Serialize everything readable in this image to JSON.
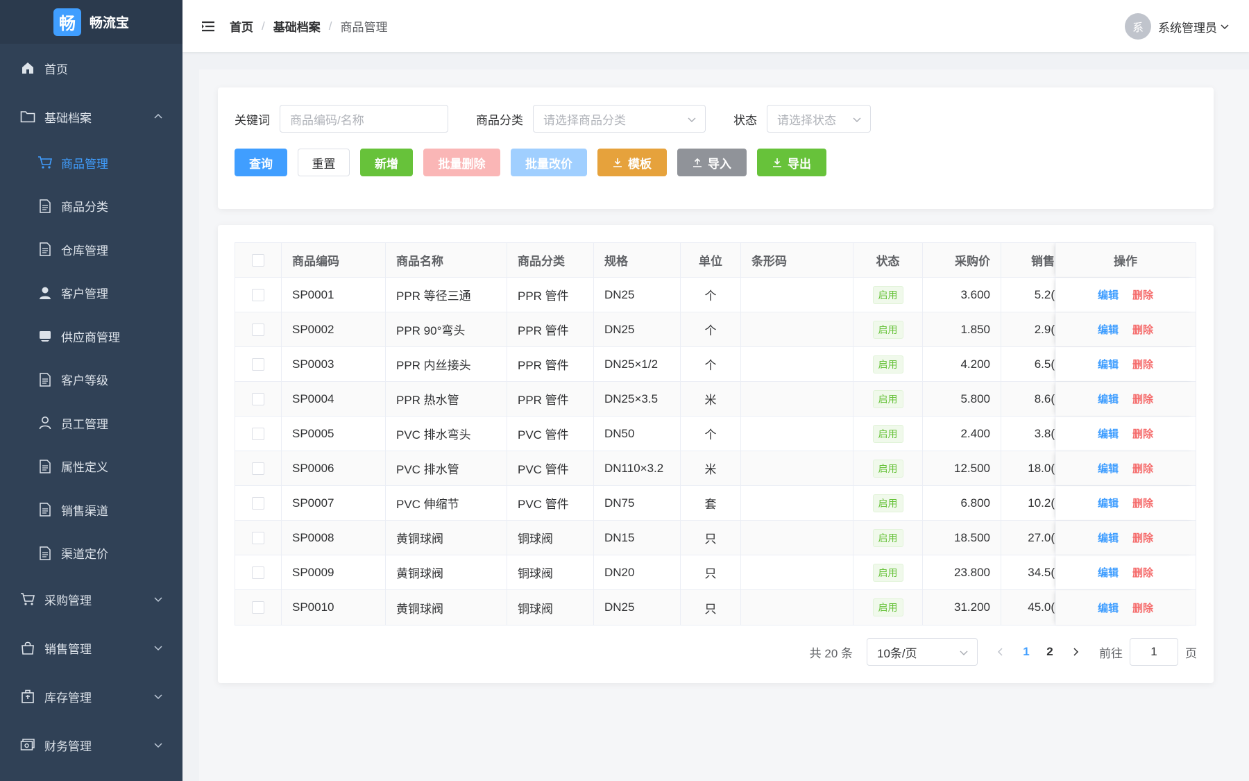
{
  "app": {
    "logo_char": "畅",
    "name": "畅流宝"
  },
  "sidebar": {
    "items": [
      {
        "label": "首页",
        "icon": "home-icon"
      },
      {
        "label": "基础档案",
        "icon": "folder-icon",
        "expanded": true
      },
      {
        "label": "采购管理",
        "icon": "cart-icon"
      },
      {
        "label": "销售管理",
        "icon": "bag-icon"
      },
      {
        "label": "库存管理",
        "icon": "box-icon"
      },
      {
        "label": "财务管理",
        "icon": "money-icon"
      }
    ],
    "sub_items": [
      {
        "label": "商品管理",
        "icon": "cart-icon",
        "active": true
      },
      {
        "label": "商品分类",
        "icon": "document-icon"
      },
      {
        "label": "仓库管理",
        "icon": "document-icon"
      },
      {
        "label": "客户管理",
        "icon": "user-filled-icon"
      },
      {
        "label": "供应商管理",
        "icon": "truck-icon"
      },
      {
        "label": "客户等级",
        "icon": "document-icon"
      },
      {
        "label": "员工管理",
        "icon": "user-icon"
      },
      {
        "label": "属性定义",
        "icon": "document-icon"
      },
      {
        "label": "销售渠道",
        "icon": "document-icon"
      },
      {
        "label": "渠道定价",
        "icon": "document-icon"
      }
    ]
  },
  "header": {
    "breadcrumb": [
      "首页",
      "基础档案",
      "商品管理"
    ],
    "separator": "/",
    "user": {
      "avatar_char": "系",
      "name": "系统管理员"
    }
  },
  "search": {
    "keyword_label": "关键词",
    "keyword_placeholder": "商品编码/名称",
    "category_label": "商品分类",
    "category_placeholder": "请选择商品分类",
    "status_label": "状态",
    "status_placeholder": "请选择状态"
  },
  "toolbar": {
    "query": "查询",
    "reset": "重置",
    "add": "新增",
    "batch_delete": "批量删除",
    "batch_price": "批量改价",
    "template": "模板",
    "import": "导入",
    "export": "导出"
  },
  "table": {
    "headers": {
      "code": "商品编码",
      "name": "商品名称",
      "category": "商品分类",
      "spec": "规格",
      "unit": "单位",
      "barcode": "条形码",
      "status": "状态",
      "buy_price": "采购价",
      "sell_price": "销售",
      "ops": "操作"
    },
    "op_edit": "编辑",
    "op_delete": "删除",
    "rows": [
      {
        "code": "SP0001",
        "name": "PPR 等径三通",
        "category": "PPR 管件",
        "spec": "DN25",
        "unit": "个",
        "barcode": "",
        "status": "启用",
        "buy": "3.600",
        "sell": "5.2("
      },
      {
        "code": "SP0002",
        "name": "PPR 90°弯头",
        "category": "PPR 管件",
        "spec": "DN25",
        "unit": "个",
        "barcode": "",
        "status": "启用",
        "buy": "1.850",
        "sell": "2.9("
      },
      {
        "code": "SP0003",
        "name": "PPR 内丝接头",
        "category": "PPR 管件",
        "spec": "DN25×1/2",
        "unit": "个",
        "barcode": "",
        "status": "启用",
        "buy": "4.200",
        "sell": "6.5("
      },
      {
        "code": "SP0004",
        "name": "PPR 热水管",
        "category": "PPR 管件",
        "spec": "DN25×3.5",
        "unit": "米",
        "barcode": "",
        "status": "启用",
        "buy": "5.800",
        "sell": "8.6("
      },
      {
        "code": "SP0005",
        "name": "PVC 排水弯头",
        "category": "PVC 管件",
        "spec": "DN50",
        "unit": "个",
        "barcode": "",
        "status": "启用",
        "buy": "2.400",
        "sell": "3.8("
      },
      {
        "code": "SP0006",
        "name": "PVC 排水管",
        "category": "PVC 管件",
        "spec": "DN110×3.2",
        "unit": "米",
        "barcode": "",
        "status": "启用",
        "buy": "12.500",
        "sell": "18.0("
      },
      {
        "code": "SP0007",
        "name": "PVC 伸缩节",
        "category": "PVC 管件",
        "spec": "DN75",
        "unit": "套",
        "barcode": "",
        "status": "启用",
        "buy": "6.800",
        "sell": "10.2("
      },
      {
        "code": "SP0008",
        "name": "黄铜球阀",
        "category": "铜球阀",
        "spec": "DN15",
        "unit": "只",
        "barcode": "",
        "status": "启用",
        "buy": "18.500",
        "sell": "27.0("
      },
      {
        "code": "SP0009",
        "name": "黄铜球阀",
        "category": "铜球阀",
        "spec": "DN20",
        "unit": "只",
        "barcode": "",
        "status": "启用",
        "buy": "23.800",
        "sell": "34.5("
      },
      {
        "code": "SP0010",
        "name": "黄铜球阀",
        "category": "铜球阀",
        "spec": "DN25",
        "unit": "只",
        "barcode": "",
        "status": "启用",
        "buy": "31.200",
        "sell": "45.0("
      }
    ]
  },
  "pagination": {
    "total_text": "共 20 条",
    "page_size": "10条/页",
    "pages": [
      "1",
      "2"
    ],
    "current": "1",
    "goto_label": "前往",
    "goto_value": "1",
    "page_suffix": "页"
  },
  "colors": {
    "primary": "#409eff",
    "success": "#67c23a",
    "danger": "#f56c6c",
    "warning": "#e6a23c",
    "sidebar_bg": "#304156"
  }
}
